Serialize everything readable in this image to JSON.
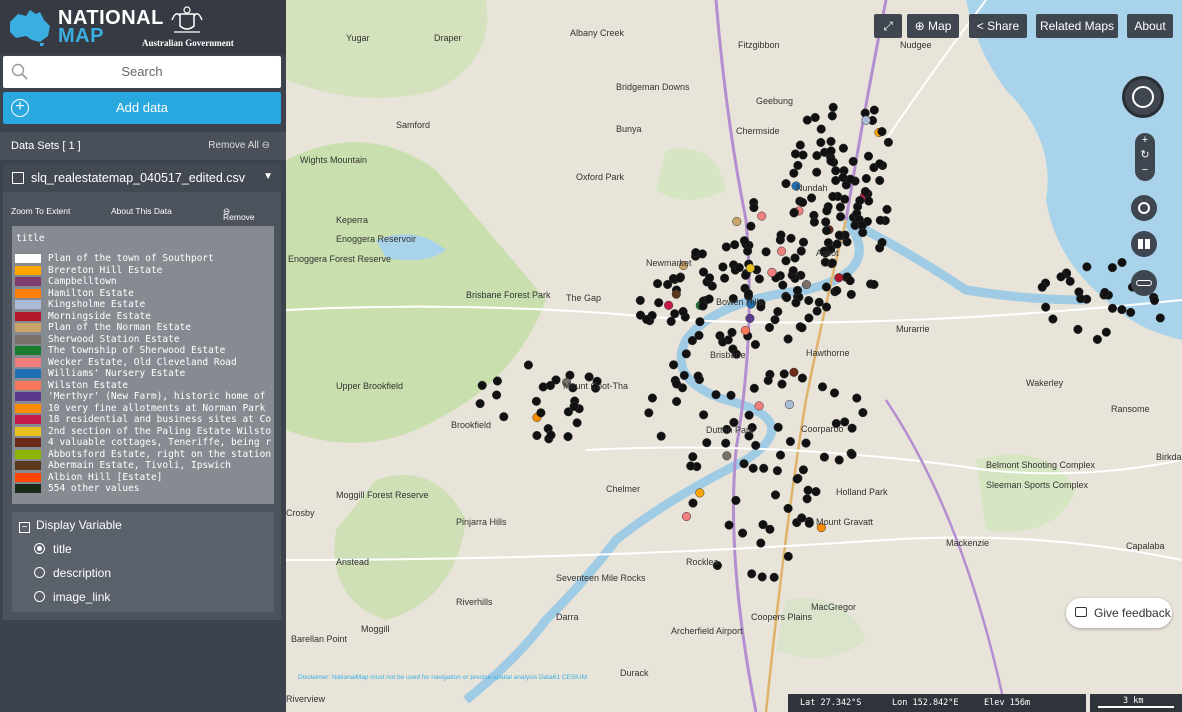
{
  "brand": {
    "line1": "NATIONAL",
    "line2": "MAP",
    "gov_label": "Australian Government"
  },
  "search": {
    "label": "Search"
  },
  "add_data": {
    "label": "Add data"
  },
  "datasets": {
    "title": "Data Sets  [ 1 ]",
    "remove_all": "Remove All"
  },
  "dataset": {
    "name": "slq_realestatemap_040517_edited.csv",
    "zoom_to_extent": "Zoom To Extent",
    "about": "About This Data",
    "remove": "Remove"
  },
  "legend": {
    "title": "title",
    "items": [
      {
        "label": "Plan of the town of Southport",
        "color": "#ffffff"
      },
      {
        "label": "Brereton Hill Estate",
        "color": "#ffa500"
      },
      {
        "label": "Campbelltown",
        "color": "#7f3b6e"
      },
      {
        "label": "Hamilton Estate",
        "color": "#ff7f0e"
      },
      {
        "label": "Kingsholme Estate",
        "color": "#a9bbd6"
      },
      {
        "label": "Morningside Estate",
        "color": "#b2182b"
      },
      {
        "label": "Plan of the Norman Estate",
        "color": "#c8a46a"
      },
      {
        "label": "Sherwood Station Estate",
        "color": "#7a706b"
      },
      {
        "label": "The township of Sherwood Estate",
        "color": "#1a7a2e"
      },
      {
        "label": "Wecker Estate, Old Cleveland Road",
        "color": "#f08080"
      },
      {
        "label": "Williams' Nursery Estate",
        "color": "#1f6fb4"
      },
      {
        "label": "Wilston Estate",
        "color": "#f7785a"
      },
      {
        "label": "'Merthyr' (New Farm), historic home of",
        "color": "#5b3a8c"
      },
      {
        "label": "10 very fine allotments at Norman Park",
        "color": "#ff8c00"
      },
      {
        "label": "18 residential and business sites at Co",
        "color": "#c51b4a"
      },
      {
        "label": "2nd section of the Paling Estate Wilsto",
        "color": "#e8c020"
      },
      {
        "label": "4 valuable cottages, Teneriffe, being r",
        "color": "#6b2a1a"
      },
      {
        "label": "Abbotsford Estate, right on the station",
        "color": "#8db600"
      },
      {
        "label": "Abermain Estate, Tivoli, Ipswich",
        "color": "#5a3a1a"
      },
      {
        "label": "Albion Hill [Estate]",
        "color": "#ff4500"
      },
      {
        "label": "554 other values",
        "color": "#1a2a1a"
      }
    ]
  },
  "display_variable": {
    "heading": "Display Variable",
    "options": [
      {
        "label": "title",
        "selected": true
      },
      {
        "label": "description",
        "selected": false
      },
      {
        "label": "image_link",
        "selected": false
      }
    ]
  },
  "toolbar": {
    "map": "Map",
    "share": "Share",
    "related_maps": "Related Maps",
    "about": "About"
  },
  "feedback": {
    "label": "Give feedback"
  },
  "status": {
    "lat": "Lat  27.342°S",
    "lon": "Lon  152.842°E",
    "elev": "Elev  156m",
    "scale": "3 km"
  },
  "disclaimer": "Disclaimer: NationalMap must not be used for navigation or precise spatial analysis   Data61   CESIUM",
  "places": [
    "Yugar",
    "Draper",
    "Albany Creek",
    "Fitzgibbon",
    "Nudgee",
    "Bridgeman Downs",
    "Geebung",
    "Samford",
    "Bunya",
    "Chermside",
    "Wights Mountain",
    "Oxford Park",
    "Nundah",
    "Keperra",
    "Enoggera Reservoir",
    "Enoggera Forest Reserve",
    "Newmarket",
    "Ascot",
    "The Gap",
    "Brisbane Forest Park",
    "Bowen Hills",
    "Murarrie",
    "Hawthorne",
    "Brisbane",
    "Upper Brookfield",
    "Mount Coot-Tha",
    "Wakerley",
    "Brookfield",
    "Dutton Park",
    "Coorparoo",
    "Ransome",
    "Chelmer",
    "Holland Park",
    "Belmont Shooting Complex",
    "Birkdale",
    "Crosby",
    "Pinjarra Hills",
    "Mount Gravatt",
    "Mackenzie",
    "Anstead",
    "Rocklea",
    "Seventeen Mile Rocks",
    "Capalaba",
    "Riverhills",
    "MacGregor",
    "Darra",
    "Coopers Plains",
    "Moggill",
    "Archerfield Airport",
    "Barellan Point",
    "Durack",
    "Riverview",
    "Moggill Forest Reserve",
    "Sleeman Sports Complex"
  ]
}
